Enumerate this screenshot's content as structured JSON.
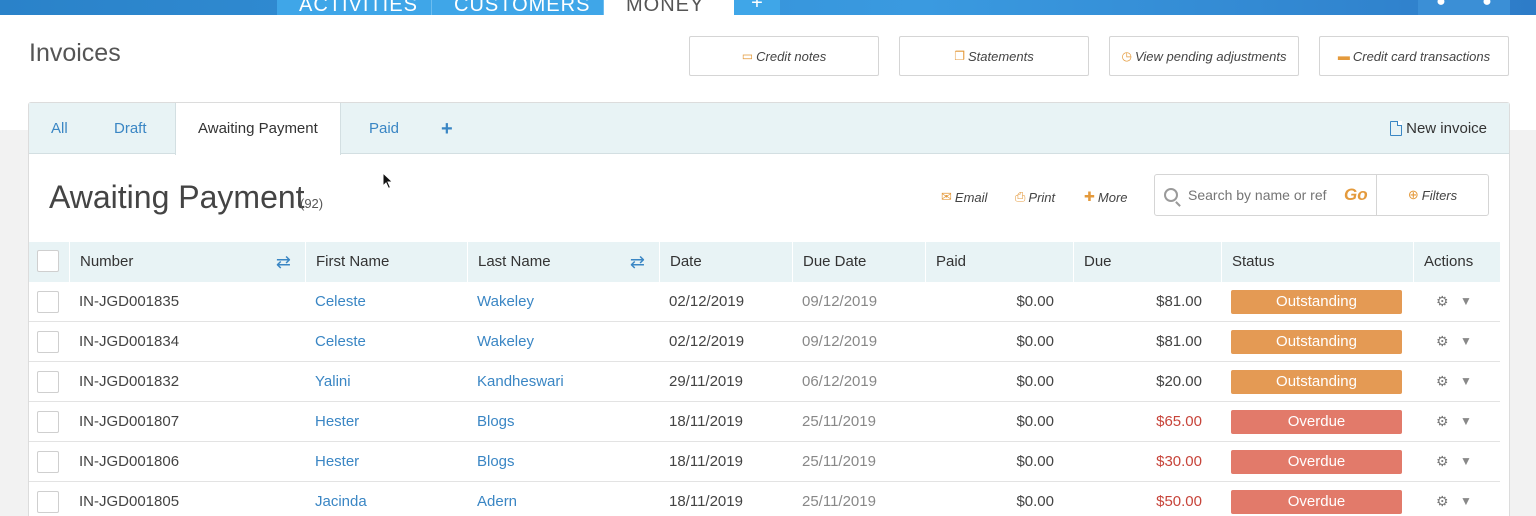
{
  "topnav": {
    "tabs": [
      {
        "label": "ACTIVITIES"
      },
      {
        "label": "CUSTOMERS"
      },
      {
        "label": "MONEY"
      }
    ],
    "plus_label": "+"
  },
  "page": {
    "title": "Invoices"
  },
  "header_buttons": {
    "credit_notes": "Credit notes",
    "statements": "Statements",
    "pending": "View pending adjustments",
    "cc_transactions": "Credit card transactions"
  },
  "tabs": {
    "all": "All",
    "draft": "Draft",
    "awaiting": "Awaiting Payment",
    "paid": "Paid",
    "add": "+",
    "new_invoice": "New invoice"
  },
  "section": {
    "title": "Awaiting Payment",
    "count": "(92)"
  },
  "actions": {
    "email": "Email",
    "print": "Print",
    "more": "More",
    "filters": "Filters"
  },
  "search": {
    "placeholder": "Search by name or ref",
    "go": "Go"
  },
  "table": {
    "headers": {
      "number": "Number",
      "first_name": "First Name",
      "last_name": "Last Name",
      "date": "Date",
      "due_date": "Due Date",
      "paid": "Paid",
      "due": "Due",
      "status": "Status",
      "actions": "Actions"
    },
    "rows": [
      {
        "number": "IN-JGD001835",
        "first": "Celeste",
        "last": "Wakeley",
        "date": "02/12/2019",
        "due_date": "09/12/2019",
        "paid": "$0.00",
        "due": "$81.00",
        "status": "Outstanding"
      },
      {
        "number": "IN-JGD001834",
        "first": "Celeste",
        "last": "Wakeley",
        "date": "02/12/2019",
        "due_date": "09/12/2019",
        "paid": "$0.00",
        "due": "$81.00",
        "status": "Outstanding"
      },
      {
        "number": "IN-JGD001832",
        "first": "Yalini",
        "last": "Kandheswari",
        "date": "29/11/2019",
        "due_date": "06/12/2019",
        "paid": "$0.00",
        "due": "$20.00",
        "status": "Outstanding"
      },
      {
        "number": "IN-JGD001807",
        "first": "Hester",
        "last": "Blogs",
        "date": "18/11/2019",
        "due_date": "25/11/2019",
        "paid": "$0.00",
        "due": "$65.00",
        "status": "Overdue"
      },
      {
        "number": "IN-JGD001806",
        "first": "Hester",
        "last": "Blogs",
        "date": "18/11/2019",
        "due_date": "25/11/2019",
        "paid": "$0.00",
        "due": "$30.00",
        "status": "Overdue"
      },
      {
        "number": "IN-JGD001805",
        "first": "Jacinda",
        "last": "Adern",
        "date": "18/11/2019",
        "due_date": "25/11/2019",
        "paid": "$0.00",
        "due": "$50.00",
        "status": "Overdue"
      }
    ]
  },
  "colors": {
    "accent": "#3a86c4",
    "orange": "#e49a3c",
    "outstanding": "#e49a54",
    "overdue": "#e27a6a"
  }
}
